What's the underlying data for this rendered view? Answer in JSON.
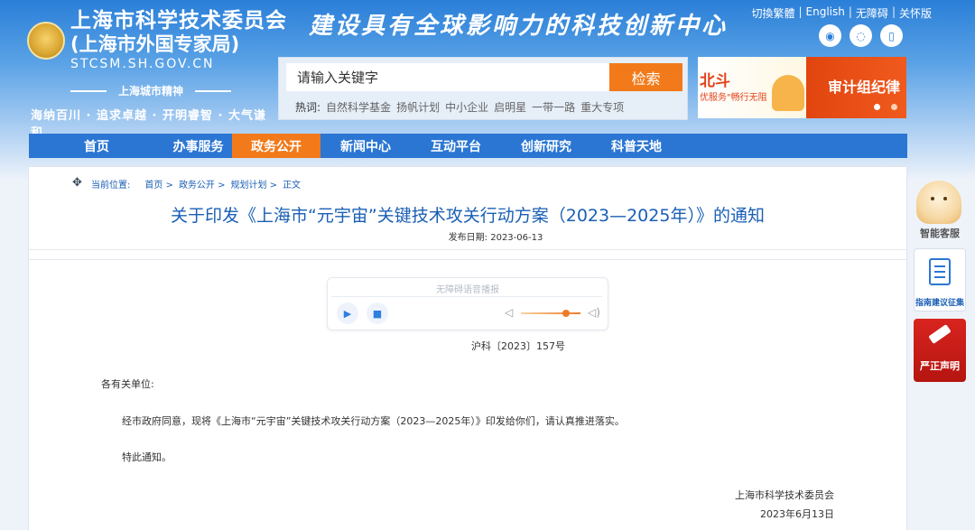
{
  "header": {
    "org_name_line1": "上海市科学技术委员会",
    "org_name_line2": "(上海市外国专家局)",
    "org_domain": "STCSM.SH.GOV.CN",
    "logo_text": "",
    "slogan": "建设具有全球影响力的科技创新中心",
    "city_spirit_title": "上海城市精神",
    "city_spirit_motto": "海纳百川 · 追求卓越 · 开明睿智 · 大气谦和"
  },
  "toplinks": {
    "traditional": "切換繁體",
    "english": "English",
    "accessibility": "无障碍",
    "elderly": "关怀版",
    "separator": "|"
  },
  "social": {
    "weibo_icon": "weibo-icon",
    "wechat_icon": "wechat-icon",
    "mobile_icon": "mobile-icon"
  },
  "search": {
    "placeholder": "请输入关键字",
    "button": "检索",
    "hot_label": "热词:",
    "hot_words": [
      "自然科学基金",
      "扬帆计划",
      "中小企业",
      "启明星",
      "一带一路",
      "重大专项"
    ]
  },
  "banner": {
    "left_title": "北斗",
    "left_sub": "优服务\"畅行无阻",
    "right_title": "审计组纪律"
  },
  "nav": {
    "items": [
      "首页",
      "办事服务",
      "政务公开",
      "新闻中心",
      "互动平台",
      "创新研究",
      "科普天地"
    ],
    "active_index": 2
  },
  "breadcrumb": {
    "label": "当前位置:",
    "items": [
      "首页 >",
      "政务公开 >",
      "规划计划 >",
      "正文"
    ]
  },
  "article": {
    "title": "关于印发《上海市“元宇宙”关键技术攻关行动方案（2023—2025年）》的通知",
    "pubdate_label": "发布日期:",
    "pubdate": "2023-06-13",
    "doc_number": "沪科〔2023〕157号",
    "salutation": "各有关单位:",
    "body": "经市政府同意，现将《上海市“元宇宙”关键技术攻关行动方案（2023—2025年）》印发给你们，请认真推进落实。",
    "closing": "特此通知。",
    "signature_org": "上海市科学技术委员会",
    "signature_date": "2023年6月13日"
  },
  "player": {
    "title": "无障碍语音播报",
    "play_icon": "play-icon",
    "stop_icon": "stop-icon",
    "volume_level": 0.75
  },
  "side": {
    "bot_label": "智能客服",
    "guide_label": "指南建议征集",
    "statement_label": "严正声明"
  },
  "colors": {
    "brand_blue": "#2b76d3",
    "accent_orange": "#f27a1a",
    "link_blue": "#1a5fb5"
  }
}
